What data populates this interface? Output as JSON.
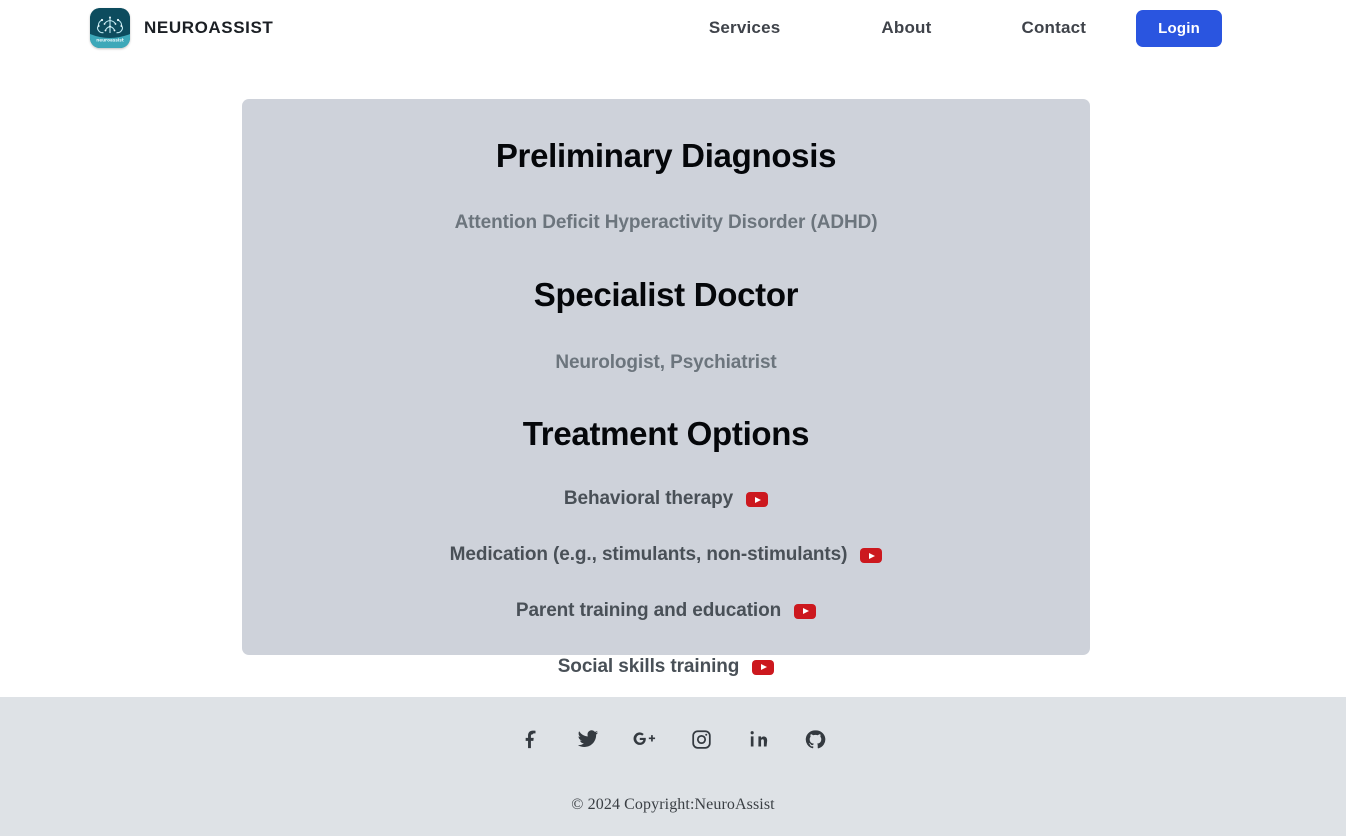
{
  "header": {
    "brand": {
      "name": "NEUROASSIST",
      "logo_icon": "brain-logo-icon",
      "logo_caption": "neuroassist"
    },
    "nav": [
      {
        "label": "Services"
      },
      {
        "label": "About"
      },
      {
        "label": "Contact"
      }
    ],
    "login_label": "Login",
    "login_color": "#2a55e0"
  },
  "card": {
    "diagnosis_title": "Preliminary Diagnosis",
    "diagnosis_value": "Attention Deficit Hyperactivity Disorder (ADHD)",
    "specialist_title": "Specialist Doctor",
    "specialist_value": "Neurologist, Psychiatrist",
    "treatment_title": "Treatment Options",
    "treatments": [
      {
        "label": "Behavioral therapy",
        "video_icon": "youtube-icon"
      },
      {
        "label": "Medication (e.g., stimulants, non-stimulants)",
        "video_icon": "youtube-icon"
      },
      {
        "label": "Parent training and education",
        "video_icon": "youtube-icon"
      },
      {
        "label": "Social skills training",
        "video_icon": "youtube-icon"
      }
    ],
    "background": "#ced2da",
    "title_color": "#05070a",
    "value_color": "#6c757d"
  },
  "footer": {
    "social": [
      {
        "name": "facebook-icon"
      },
      {
        "name": "twitter-icon"
      },
      {
        "name": "google-plus-icon"
      },
      {
        "name": "instagram-icon"
      },
      {
        "name": "linkedin-icon"
      },
      {
        "name": "github-icon"
      }
    ],
    "copyright": "© 2024 Copyright:NeuroAssist",
    "background": "#dee2e6"
  }
}
